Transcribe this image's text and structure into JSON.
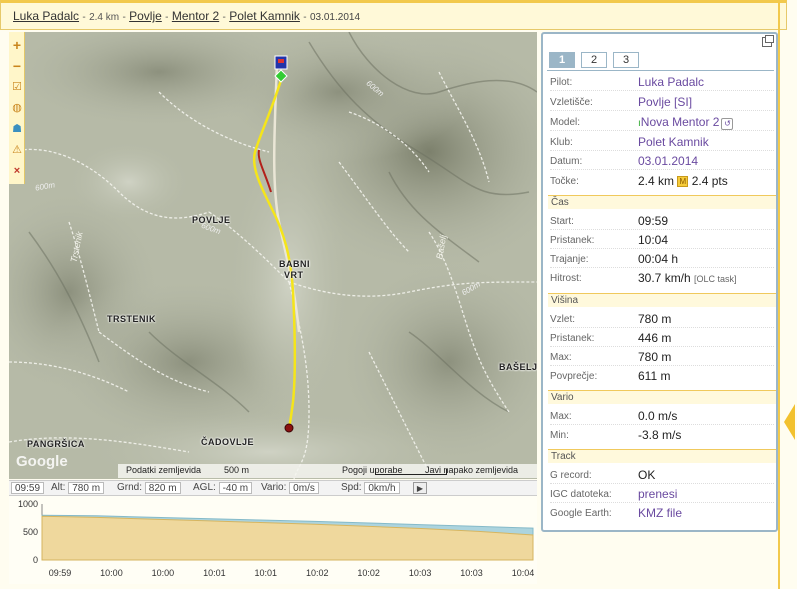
{
  "title": {
    "pilot": "Luka Padalc",
    "distance": "2.4 km",
    "sep": "-",
    "takeoff": "Povlje",
    "model": "Mentor 2",
    "club": "Polet Kamnik",
    "date": "03.01.2014"
  },
  "map_tools": [
    "plus-icon",
    "minus-icon",
    "checkbox-icon",
    "globe-icon",
    "hat-icon",
    "warning-icon",
    "close-icon"
  ],
  "map_labels": {
    "povlje": "POVLJE",
    "babni_vrt_1": "BABNI",
    "babni_vrt_2": "VRT",
    "trstenik": "TRSTENIK",
    "trstenik_road": "Trstenik",
    "basejl_road": "Bašelj",
    "baselj": "BAŠELJ",
    "pangrsica": "PANGRŠICA",
    "cadovlje": "ČADOVLJE",
    "c600a": "600m",
    "c600b": "600m",
    "c600c": "600m",
    "c600d": "600m"
  },
  "attribution": {
    "logo": "Google",
    "data": "Podatki zemljevida",
    "scale": "500 m",
    "terms": "Pogoji uporabe",
    "report": "Javi napako zemljevida"
  },
  "instruments": {
    "time": "09:59",
    "alt_label": "Alt:",
    "alt": "780 m",
    "grnd_label": "Grnd:",
    "grnd": "820 m",
    "agl_label": "AGL:",
    "agl": "-40 m",
    "vario_label": "Vario:",
    "vario": "0m/s",
    "spd_label": "Spd:",
    "spd": "0km/h"
  },
  "panel": {
    "tabs": [
      "1",
      "2",
      "3"
    ],
    "pilot_label": "Pilot:",
    "pilot": "Luka Padalc",
    "takeoff_label": "Vzletišče:",
    "takeoff": "Povlje [SI]",
    "model_label": "Model:",
    "model": "Nova Mentor 2",
    "club_label": "Klub:",
    "club": "Polet Kamnik",
    "date_label": "Datum:",
    "date": "03.01.2014",
    "points_label": "Točke:",
    "points_km": "2.4 km",
    "points_badge": "M",
    "points_pts": "2.4 pts",
    "time_section": "Čas",
    "start_label": "Start:",
    "start": "09:59",
    "landing_label": "Pristanek:",
    "landing": "10:04",
    "duration_label": "Trajanje:",
    "duration": "00:04 h",
    "speed_label": "Hitrost:",
    "speed": "30.7 km/h",
    "speed_note": "[OLC task]",
    "height_section": "Višina",
    "takeoff_alt_label": "Vzlet:",
    "takeoff_alt": "780 m",
    "landing_alt_label": "Pristanek:",
    "landing_alt": "446 m",
    "max_alt_label": "Max:",
    "max_alt": "780 m",
    "avg_alt_label": "Povprečje:",
    "avg_alt": "611 m",
    "vario_section": "Vario",
    "vmax_label": "Max:",
    "vmax": "0.0 m/s",
    "vmin_label": "Min:",
    "vmin": "-3.8 m/s",
    "track_section": "Track",
    "grecord_label": "G record:",
    "grecord": "OK",
    "igc_label": "IGC datoteka:",
    "igc": "prenesi",
    "ge_label": "Google Earth:",
    "ge": "KMZ file"
  },
  "chart_data": {
    "type": "area",
    "y_ticks": [
      "1000",
      "500",
      "0"
    ],
    "ylim": [
      0,
      1000
    ],
    "x_ticks": [
      "09:59",
      "10:00",
      "10:00",
      "10:01",
      "10:01",
      "10:02",
      "10:02",
      "10:03",
      "10:03",
      "10:04"
    ],
    "series": [
      {
        "values": [
          800,
          790,
          765,
          740,
          715,
          690,
          660,
          630,
          600,
          570
        ]
      },
      {
        "values": [
          780,
          760,
          730,
          700,
          670,
          640,
          600,
          560,
          510,
          446
        ]
      }
    ],
    "colors": [
      "#a8d2dd",
      "#f3d99a"
    ]
  },
  "colors": {
    "accent": "#f2c94c",
    "panel_border": "#9bb6c7",
    "track": "#f5e51a",
    "link": "#6a4aa0"
  }
}
